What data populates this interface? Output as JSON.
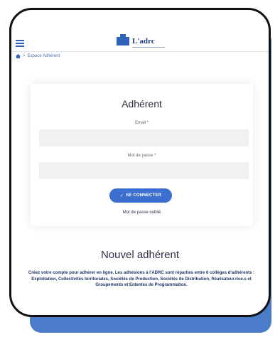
{
  "colors": {
    "accent": "#3a6fd0",
    "shadow_card": "#4a7cc9",
    "required": "#b64a4a",
    "text_dark": "#2e2e43"
  },
  "header": {
    "menu_icon": "hamburger-icon",
    "logo_text": "L'adrc"
  },
  "breadcrumb": {
    "home_icon": "home-icon",
    "separator": ">",
    "current": "Espace Adhérent"
  },
  "login": {
    "title": "Adhérent",
    "email_label": "Email",
    "password_label": "Mot de passe",
    "required_mark": "*",
    "email_value": "",
    "password_value": "",
    "submit_icon": "check-icon",
    "submit_label": "SE CONNECTER",
    "forgot_label": "Mot de passe oublié"
  },
  "register": {
    "title": "Nouvel adhérent",
    "description": "Créez votre compte pour adhérer en ligne. Les adhésions à l'ADRC sont réparties entre 6 collèges d'adhérents : Exploitation, Collectivités territoriales, Sociétés de Production, Sociétés de Distribution, Réalisateur.rice.s et Groupements et Ententes de Programmation."
  }
}
